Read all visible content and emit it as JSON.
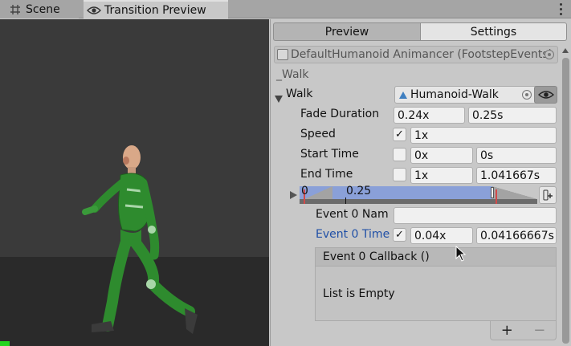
{
  "tabs": {
    "scene_label": "Scene",
    "transition_label": "Transition Preview"
  },
  "icons": {
    "scene": "grid-hash-icon",
    "transition": "eye-icon",
    "menu": "kebab-menu-icon",
    "object": "script-object-icon",
    "clip": "animation-clip-icon"
  },
  "colors": {
    "accent_link": "#1f4fa6",
    "timeline_fill": "#8aa0d8",
    "marker_red": "#d24a4a",
    "indicator_green": "#22d41f"
  },
  "inspector": {
    "preview_tab": "Preview",
    "settings_tab": "Settings",
    "object_field": "DefaultHumanoid Animancer (FootstepEvents)",
    "name_label": "_Walk",
    "walk_label": "Walk",
    "clip_value": "Humanoid-Walk",
    "fade_duration": {
      "label": "Fade Duration",
      "normalized": "0.24x",
      "seconds": "0.25s"
    },
    "speed": {
      "label": "Speed",
      "checked": true,
      "value": "1x"
    },
    "start_time": {
      "label": "Start Time",
      "checked": false,
      "normalized": "0x",
      "seconds": "0s"
    },
    "end_time": {
      "label": "End Time",
      "checked": false,
      "normalized": "1x",
      "seconds": "1.041667s"
    },
    "timeline": {
      "start_label": "0",
      "tick_label": "0.25"
    },
    "event0": {
      "name_label": "Event 0 Nam",
      "name_value": "",
      "time_label": "Event 0 Time",
      "time_checked": true,
      "time_normalized": "0.04x",
      "time_seconds": "0.04166667s",
      "callback_label": "Event 0 Callback ()",
      "empty_text": "List is Empty",
      "add": "+",
      "remove": "−"
    }
  }
}
